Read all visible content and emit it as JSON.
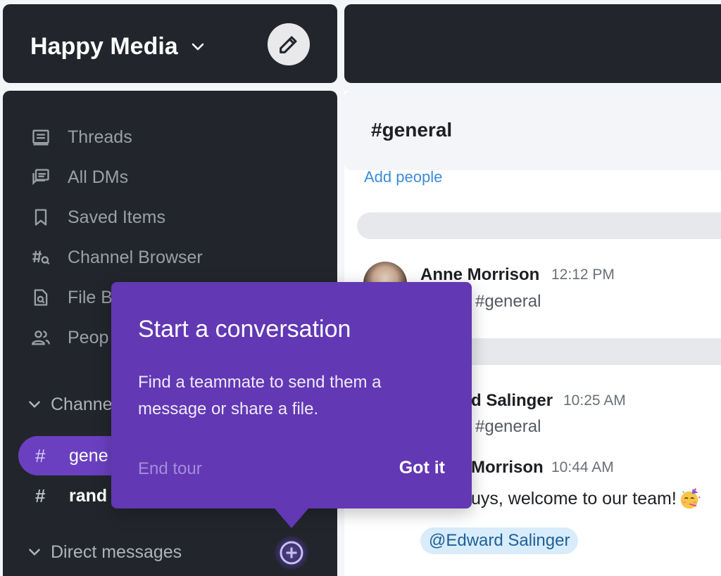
{
  "team": {
    "name": "Happy Media"
  },
  "nav": [
    {
      "label": "Threads",
      "icon": "threads-icon"
    },
    {
      "label": "All DMs",
      "icon": "all-dms-icon"
    },
    {
      "label": "Saved Items",
      "icon": "bookmark-icon"
    },
    {
      "label": "Channel Browser",
      "icon": "channel-browser-icon"
    },
    {
      "label": "File B",
      "icon": "file-search-icon"
    },
    {
      "label": "Peop",
      "icon": "people-icon"
    }
  ],
  "sections": {
    "channels": "Channe",
    "direct_messages": "Direct messages"
  },
  "channels": [
    {
      "hash": "#",
      "label": "gene"
    },
    {
      "hash": "#",
      "label": "rand"
    }
  ],
  "main": {
    "channel_title": "#general",
    "add_people": "Add people",
    "messages": [
      {
        "author": "Anne Morrison",
        "time": "12:12 PM",
        "text": "#general"
      },
      {
        "author": "d Salinger",
        "time": "10:25 AM",
        "text": "#general"
      },
      {
        "author": "Morrison",
        "time": "10:44 AM",
        "text": "uys, welcome to our team!"
      }
    ],
    "mention": "@Edward Salinger"
  },
  "tour": {
    "title": "Start a conversation",
    "body": "Find a teammate to send them a message or share a file.",
    "end": "End tour",
    "confirm": "Got it"
  },
  "colors": {
    "sidebar_bg": "#22262c",
    "accent": "#6a40c0",
    "tour_bg": "#6238b4",
    "link": "#3b8bd9"
  }
}
